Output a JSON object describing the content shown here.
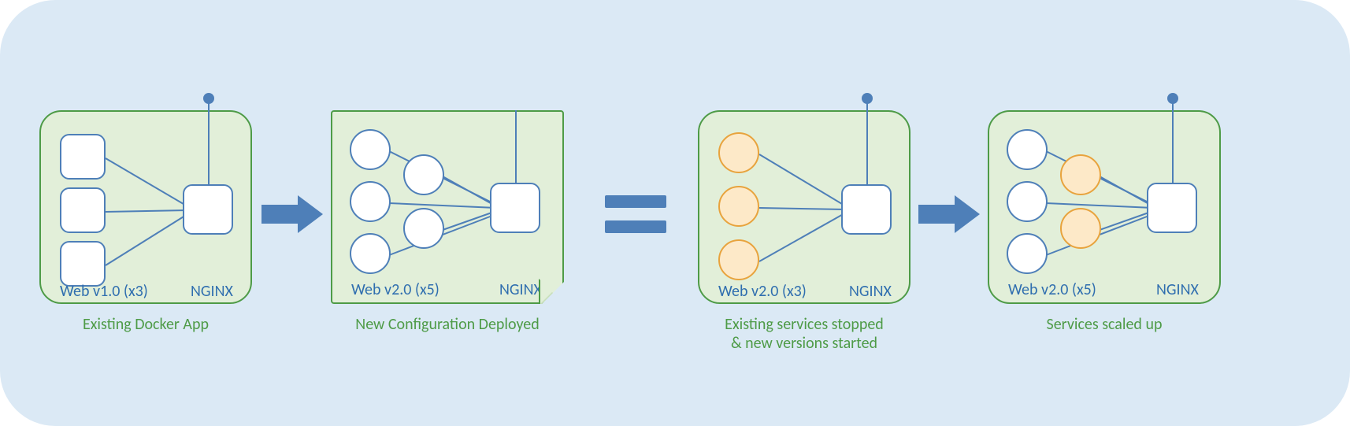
{
  "panels": {
    "existing": {
      "web_label": "Web v1.0 (x3)",
      "nginx_label": "NGINX",
      "caption": "Existing Docker App"
    },
    "new_config": {
      "web_label": "Web v2.0 (x5)",
      "nginx_label": "NGINX",
      "caption": "New Configuration Deployed"
    },
    "stopped": {
      "web_label": "Web v2.0 (x3)",
      "nginx_label": "NGINX",
      "caption": "Existing services stopped\n& new versions started"
    },
    "scaled": {
      "web_label": "Web v2.0 (x5)",
      "nginx_label": "NGINX",
      "caption": "Services scaled up"
    }
  },
  "colors": {
    "bg": "#dbe9f5",
    "panel_fill": "#e2efd9",
    "panel_border": "#4e9b47",
    "node_border": "#4e7fb8",
    "node_fill": "#ffffff",
    "orange_fill": "#fde9c8",
    "orange_border": "#e8a33d",
    "arrow": "#4e7fb8",
    "label_blue": "#2f6eaf",
    "caption_green": "#4e9b47"
  }
}
